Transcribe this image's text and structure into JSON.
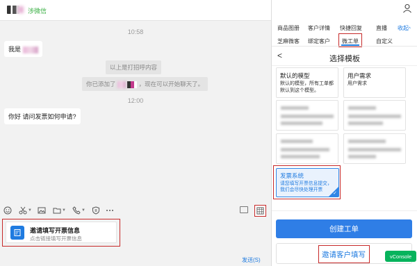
{
  "chat": {
    "contact_name": "涉微信",
    "timestamps": [
      "10:58",
      "12:00"
    ],
    "messages": [
      {
        "text": "我是"
      },
      {
        "system": "以上是打招呼内容"
      },
      {
        "system_prefix": "你已添加了",
        "system_suffix": "，现在可以开始聊天了。"
      },
      {
        "text": "你好 请问发票如何申请?"
      }
    ],
    "invite_card": {
      "title": "邀请填写开票信息",
      "subtitle": "点击链接填写开票信息"
    },
    "send_label": "发送(S)"
  },
  "toolbar": {
    "icons": [
      "emoji-icon",
      "scissors-icon",
      "image-icon",
      "folder-icon",
      "phone-icon",
      "shield-icon",
      "more-icon",
      "doc-icon",
      "grid-icon"
    ]
  },
  "sidebar": {
    "tabs_row1": [
      "商品图册",
      "客户详情",
      "快捷回复",
      "直播"
    ],
    "collapse_label": "收起",
    "tabs_row2": [
      "芝麻微客",
      "绑定客户",
      "微工单",
      "自定义"
    ],
    "active_tab": "微工单",
    "back_symbol": "<",
    "template_title": "选择模板",
    "templates": [
      {
        "title": "默认的模型",
        "desc": "默认的模型，所有工单都默认到这个模型。"
      },
      {
        "title": "用户需求",
        "desc": "用户需求"
      }
    ],
    "selected_template": {
      "title": "发票系统",
      "desc": "请您填写开票信息提交，我们会尽快处理开票"
    },
    "create_button": "创建工单",
    "invite_button": "邀请客户填写",
    "vconsole_label": "vConsole"
  },
  "colors": {
    "accent": "#2f7ee6",
    "highlight": "#c62828",
    "green": "#07b35c"
  }
}
